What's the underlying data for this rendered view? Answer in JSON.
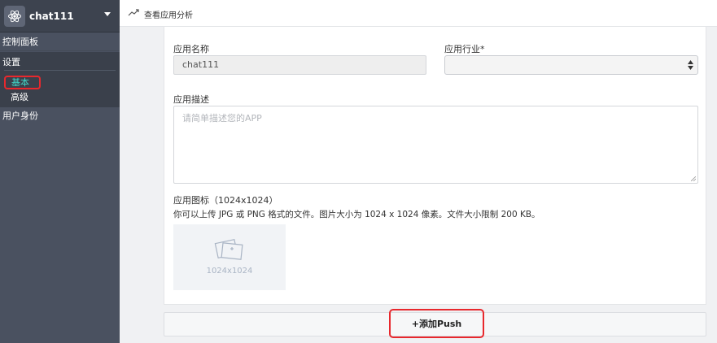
{
  "sidebar": {
    "app_name": "chat111",
    "app_icon": "react-atom-icon",
    "dashboard_label": "控制面板",
    "settings_label": "设置",
    "settings_items": [
      {
        "label": "基本",
        "active": true
      },
      {
        "label": "高级",
        "active": false
      }
    ],
    "identity_label": "用户身份"
  },
  "topbar": {
    "analytics_link": "查看应用分析",
    "analytics_icon": "trend-up-icon"
  },
  "form": {
    "name_label": "应用名称",
    "name_value": "chat111",
    "industry_label": "应用行业*",
    "industry_value": "",
    "description_label": "应用描述",
    "description_placeholder": "请简单描述您的APP",
    "icon_label": "应用图标（1024x1024）",
    "icon_hint": "你可以上传 JPG 或 PNG 格式的文件。图片大小为 1024 x 1024 像素。文件大小限制 200 KB。",
    "icon_size_text": "1024x1024"
  },
  "push": {
    "add_label": "+添加Push"
  },
  "colors": {
    "sidebar_bg": "#4a5160",
    "active_item": "#3fd6c8",
    "highlight_border": "#e8282d"
  }
}
